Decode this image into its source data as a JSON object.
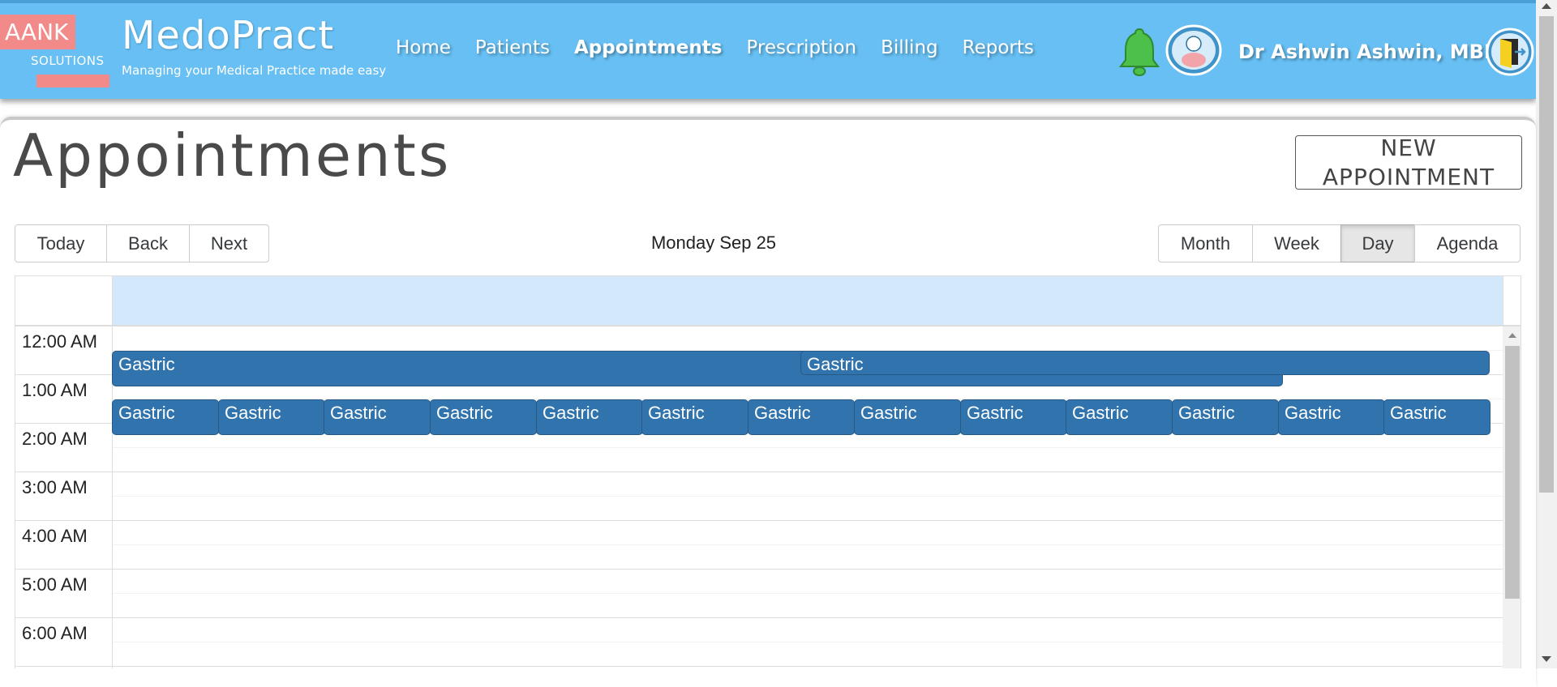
{
  "logo": {
    "line1": "AANK",
    "line2": "SOLUTIONS"
  },
  "brand": {
    "title": "MedoPract",
    "tagline": "Managing your Medical Practice made easy"
  },
  "nav": [
    {
      "label": "Home",
      "active": false
    },
    {
      "label": "Patients",
      "active": false
    },
    {
      "label": "Appointments",
      "active": true
    },
    {
      "label": "Prescription",
      "active": false
    },
    {
      "label": "Billing",
      "active": false
    },
    {
      "label": "Reports",
      "active": false
    }
  ],
  "user": {
    "name": "Dr  Ashwin  Ashwin, MBBS"
  },
  "page": {
    "title": "Appointments",
    "new_button": "NEW APPOINTMENT"
  },
  "toolbar": {
    "today": "Today",
    "back": "Back",
    "next": "Next",
    "date_label": "Monday Sep 25",
    "views": [
      "Month",
      "Week",
      "Day",
      "Agenda"
    ],
    "active_view": "Day"
  },
  "time_slots": [
    "12:00 AM",
    "1:00 AM",
    "2:00 AM",
    "3:00 AM",
    "4:00 AM",
    "5:00 AM",
    "6:00 AM"
  ],
  "events": {
    "row1": [
      "Gastric",
      "Gastric"
    ],
    "row2": [
      "Gastric",
      "Gastric",
      "Gastric",
      "Gastric",
      "Gastric",
      "Gastric",
      "Gastric",
      "Gastric",
      "Gastric",
      "Gastric",
      "Gastric",
      "Gastric",
      "Gastric"
    ]
  },
  "colors": {
    "header": "#67bff3",
    "event": "#3174ad",
    "day_header": "#d3e9fb",
    "bell": "#4cc04a",
    "logo_pink": "#f28a8a"
  }
}
